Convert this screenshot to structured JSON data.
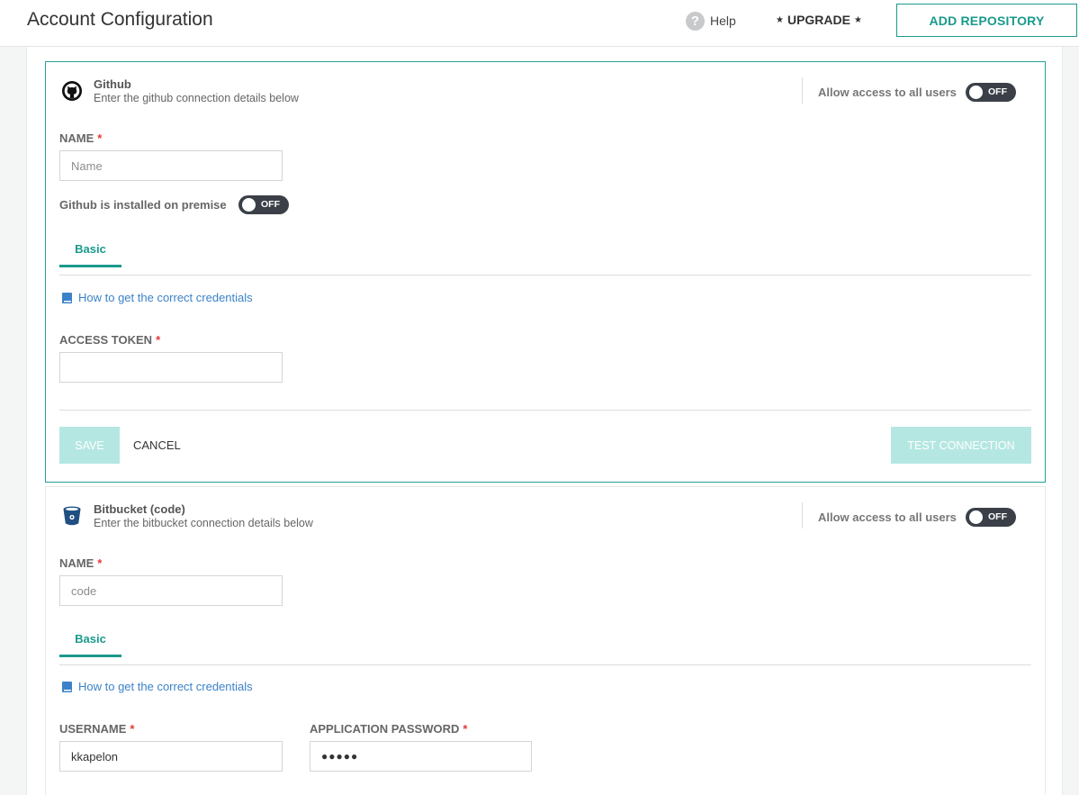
{
  "header": {
    "title": "Account Configuration",
    "help_label": "Help",
    "upgrade_label": "UPGRADE",
    "add_repository_label": "ADD REPOSITORY"
  },
  "github": {
    "title": "Github",
    "subtitle": "Enter the github connection details below",
    "allow_access_label": "Allow access to all users",
    "allow_access_state": "OFF",
    "name_label": "NAME",
    "name_value": "",
    "name_placeholder": "Name",
    "premise_label": "Github is installed on premise",
    "premise_state": "OFF",
    "tab_basic": "Basic",
    "credentials_link": "How to get the correct credentials",
    "access_token_label": "ACCESS TOKEN",
    "access_token_value": "",
    "save_label": "SAVE",
    "cancel_label": "CANCEL",
    "test_connection_label": "TEST CONNECTION"
  },
  "bitbucket": {
    "title": "Bitbucket (code)",
    "subtitle": "Enter the bitbucket connection details below",
    "allow_access_label": "Allow access to all users",
    "allow_access_state": "OFF",
    "name_label": "NAME",
    "name_value": "code",
    "tab_basic": "Basic",
    "credentials_link": "How to get the correct credentials",
    "username_label": "USERNAME",
    "username_value": "kkapelon",
    "app_password_label": "APPLICATION PASSWORD",
    "app_password_value": "●●●●●"
  },
  "icons": {
    "help": "question-circle-icon",
    "github": "github-octocat-icon",
    "bitbucket": "bitbucket-bucket-icon",
    "book": "book-icon"
  },
  "colors": {
    "accent": "#1a9a8c",
    "link": "#3b82c8",
    "required": "#e53935",
    "toggle_bg": "#3b4048",
    "disabled_button": "#b5e7e2"
  }
}
